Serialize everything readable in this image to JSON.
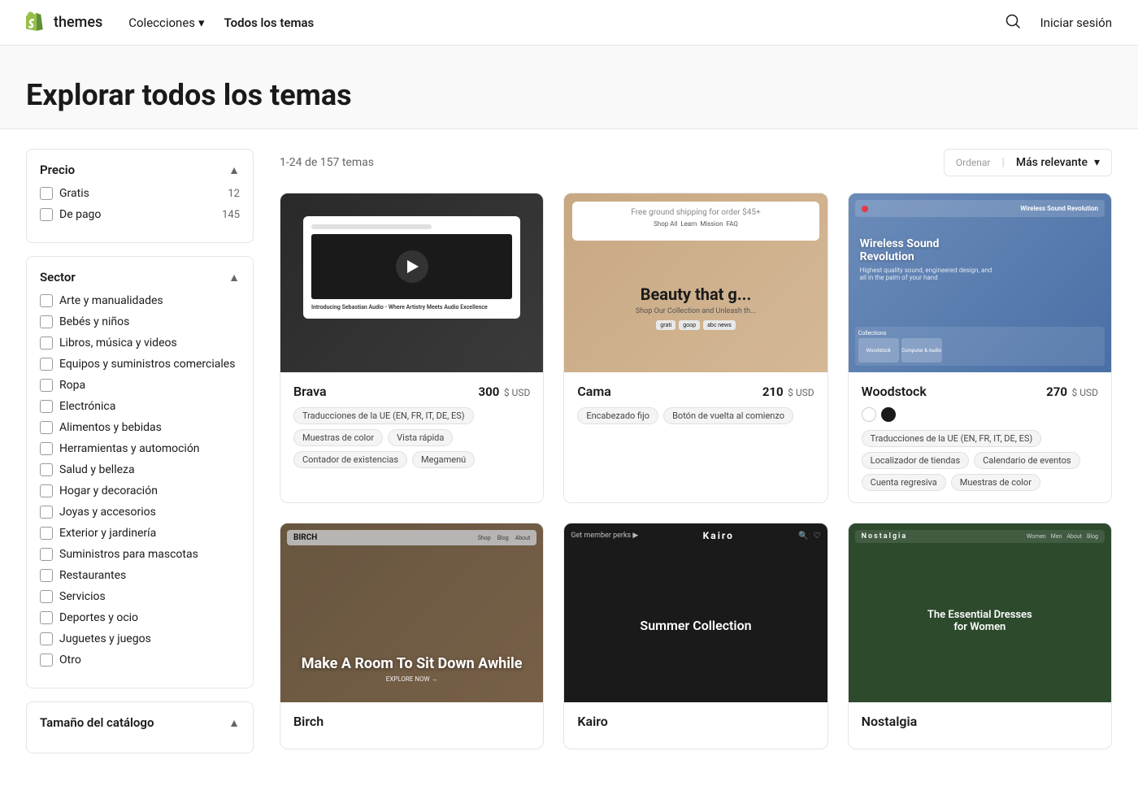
{
  "navbar": {
    "logo_text": "themes",
    "collections_label": "Colecciones",
    "all_themes_label": "Todos los temas",
    "signin_label": "Iniciar sesión"
  },
  "hero": {
    "title": "Explorar todos los temas"
  },
  "filters": {
    "price_section_title": "Precio",
    "price_items": [
      {
        "label": "Gratis",
        "count": "12"
      },
      {
        "label": "De pago",
        "count": "145"
      }
    ],
    "sector_section_title": "Sector",
    "sector_items": [
      "Arte y manualidades",
      "Bebés y niños",
      "Libros, música y videos",
      "Equipos y suministros comerciales",
      "Ropa",
      "Electrónica",
      "Alimentos y bebidas",
      "Herramientas y automoción",
      "Salud y belleza",
      "Hogar y decoración",
      "Joyas y accesorios",
      "Exterior y jardinería",
      "Suministros para mascotas",
      "Restaurantes",
      "Servicios",
      "Deportes y ocio",
      "Juguetes y juegos",
      "Otro"
    ],
    "catalog_section_title": "Tamaño del catálogo"
  },
  "results": {
    "count_text": "1-24 de 157 temas"
  },
  "sort": {
    "label": "Ordenar",
    "value": "Más relevante"
  },
  "themes": [
    {
      "name": "Brava",
      "price": "300",
      "currency": "$ USD",
      "has_swatches": false,
      "tags": [
        "Traducciones de la UE (EN, FR, IT, DE, ES)",
        "Muestras de color",
        "Vista rápida",
        "Contador de existencias",
        "Megamenú"
      ],
      "placeholder_class": "placeholder-brava",
      "mock_text": "Introducing Sebastian Audio - Where Artistry Meets Audio Excellence"
    },
    {
      "name": "Cama",
      "price": "210",
      "currency": "$ USD",
      "has_swatches": false,
      "tags": [
        "Encabezado fijo",
        "Botón de vuelta al comienzo"
      ],
      "placeholder_class": "placeholder-cama",
      "mock_text": "Beauty that gets you"
    },
    {
      "name": "Woodstock",
      "price": "270",
      "currency": "$ USD",
      "has_swatches": true,
      "swatches": [
        "white",
        "dark"
      ],
      "tags": [
        "Traducciones de la UE (EN, FR, IT, DE, ES)",
        "Localizador de tiendas",
        "Calendario de eventos",
        "Cuenta regresiva",
        "Muestras de color"
      ],
      "placeholder_class": "placeholder-woodstock",
      "mock_text": "Wireless Sound Revolution"
    },
    {
      "name": "Birch",
      "price": "",
      "currency": "",
      "has_swatches": false,
      "tags": [],
      "placeholder_class": "placeholder-birch",
      "mock_text": "Make A Room To Sit Down Awhile"
    },
    {
      "name": "Kairo",
      "price": "",
      "currency": "",
      "has_swatches": false,
      "tags": [],
      "placeholder_class": "placeholder-kairo",
      "mock_text": "Summer Collection"
    },
    {
      "name": "Nostalgia",
      "price": "",
      "currency": "",
      "has_swatches": false,
      "tags": [],
      "placeholder_class": "placeholder-nostalgia",
      "mock_text": "The Essential Dresses for Women"
    }
  ]
}
